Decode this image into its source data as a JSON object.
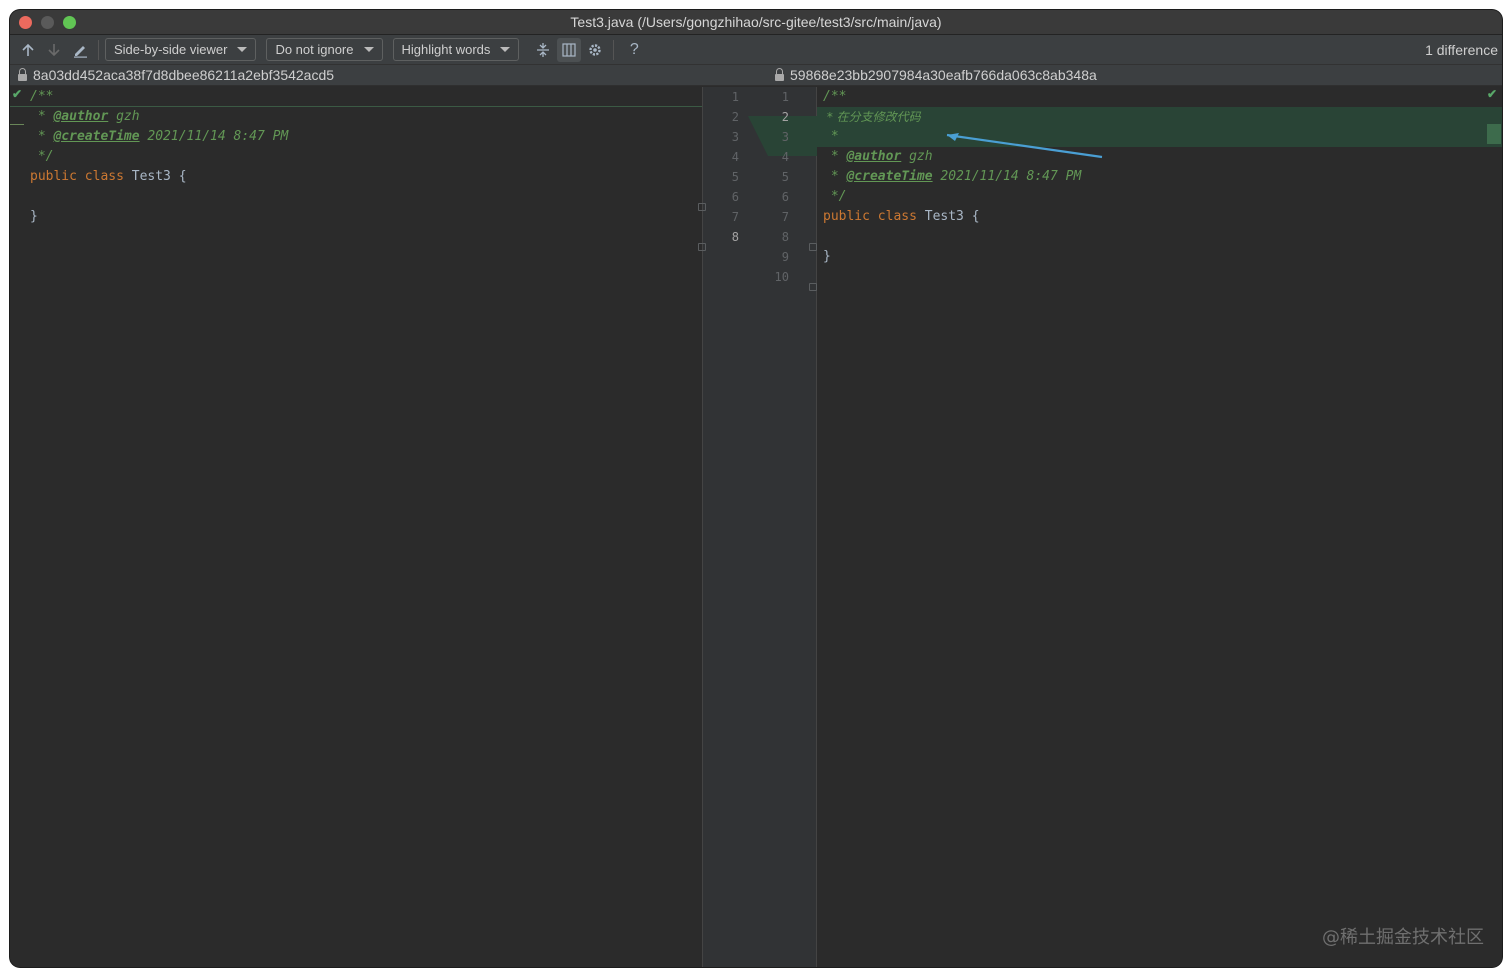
{
  "window": {
    "title": "Test3.java (/Users/gongzhihao/src-gitee/test3/src/main/java)"
  },
  "toolbar": {
    "viewer_label": "Side-by-side viewer",
    "ignore_label": "Do not ignore",
    "highlight_label": "Highlight words",
    "help_label": "?",
    "difference_count": "1 difference"
  },
  "left": {
    "hash": "8a03dd452aca38f7d8dbee86211a2ebf3542acd5",
    "lines": {
      "l1": "/**",
      "l2_star": " * ",
      "l2_tag": "@author",
      "l2_val": " gzh",
      "l3_star": " * ",
      "l3_tag": "@createTime",
      "l3_val": " 2021/11/14 8:47 PM",
      "l4": " */",
      "l5_kw": "public class",
      "l5_name": " Test3 {",
      "l7": "}"
    },
    "line_numbers": [
      "1",
      "2",
      "3",
      "4",
      "5",
      "6",
      "7",
      "8"
    ]
  },
  "right": {
    "hash": "59868e23bb2907984a30eafb766da063c8ab348a",
    "lines": {
      "l1": "/**",
      "l2": " * 在分支修改代码",
      "l3": " *",
      "l4_star": " * ",
      "l4_tag": "@author",
      "l4_val": " gzh",
      "l5_star": " * ",
      "l5_tag": "@createTime",
      "l5_val": " 2021/11/14 8:47 PM",
      "l6": " */",
      "l7_kw": "public class",
      "l7_name": " Test3 {",
      "l9": "}"
    },
    "line_numbers": [
      "1",
      "2",
      "3",
      "4",
      "5",
      "6",
      "7",
      "8",
      "9",
      "10"
    ]
  },
  "watermark": "@稀土掘金技术社区",
  "colors": {
    "added_background": "#294436",
    "comment": "#629755",
    "keyword": "#cc7832",
    "annotation_arrow": "#4a9fd4"
  }
}
